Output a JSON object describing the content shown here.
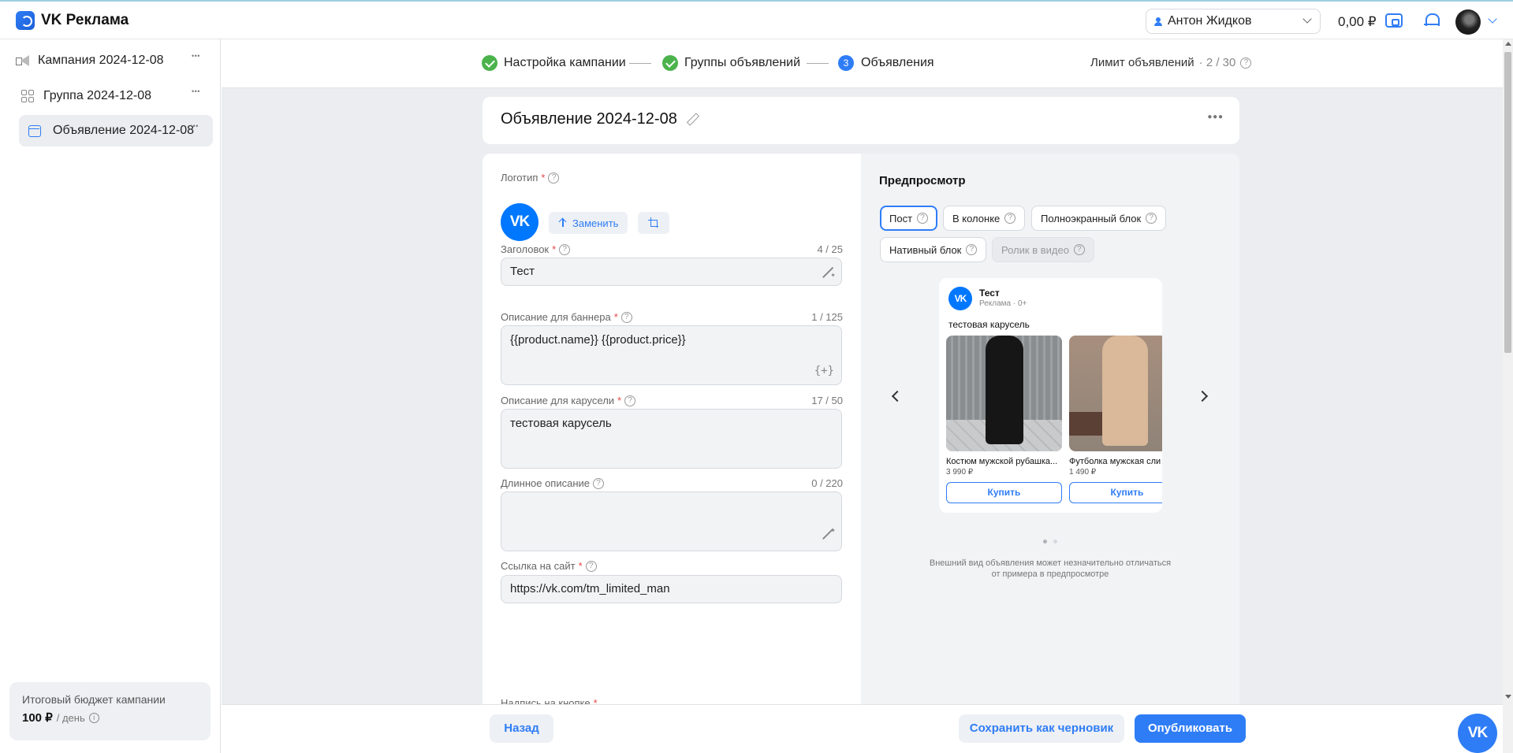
{
  "header": {
    "logo_text": "VK Реклама",
    "user_name": "Антон Жидков",
    "balance": "0,00 ₽",
    "icons": [
      "wallet-icon",
      "bell-icon",
      "avatar"
    ]
  },
  "sidebar": {
    "items": [
      {
        "label": "Кампания 2024-12-08",
        "icon": "megaphone-icon"
      },
      {
        "label": "Группа 2024-12-08",
        "icon": "grid-icon"
      },
      {
        "label": "Объявление 2024-12-08",
        "icon": "ad-icon",
        "active": true
      }
    ],
    "budget": {
      "title": "Итоговый бюджет кампании",
      "value": "100 ₽",
      "unit": "/ день"
    }
  },
  "stepper": {
    "steps": [
      {
        "label": "Настройка кампании",
        "status": "done"
      },
      {
        "label": "Группы объявлений",
        "status": "done"
      },
      {
        "label": "Объявления",
        "status": "current",
        "number": "3"
      }
    ],
    "limit_label": "Лимит объявлений",
    "limit_count": "· 2 / 30"
  },
  "ad": {
    "title": "Объявление 2024-12-08"
  },
  "form": {
    "logo": {
      "label": "Логотип",
      "logo_text": "VK",
      "replace_label": "Заменить"
    },
    "headline": {
      "label": "Заголовок",
      "count": "4 / 25",
      "value": "Тест"
    },
    "banner_desc": {
      "label": "Описание для баннера",
      "count": "1 / 125",
      "value": "{{product.name}} {{product.price}}",
      "var_icon": "{+}"
    },
    "carousel_desc": {
      "label": "Описание для карусели",
      "count": "17 / 50",
      "value": "тестовая карусель"
    },
    "long_desc": {
      "label": "Длинное описание",
      "count": "0 / 220",
      "value": ""
    },
    "site_link": {
      "label": "Ссылка на сайт",
      "value": "https://vk.com/tm_limited_man"
    },
    "button_text": {
      "label": "Надпись на кнопке"
    }
  },
  "preview": {
    "title": "Предпросмотр",
    "tabs": [
      "Пост",
      "В колонке",
      "Полноэкранный блок",
      "Нативный блок",
      "Ролик в видео"
    ],
    "active_tab": "Пост",
    "disabled_tab": "Ролик в видео",
    "post": {
      "avatar_text": "VK",
      "name": "Тест",
      "meta": "Реклама · 0+",
      "text": "тестовая карусель",
      "cards": [
        {
          "title": "Костюм мужской рубашка...",
          "price": "3 990 ₽",
          "button": "Купить"
        },
        {
          "title": "Футболка мужская сли",
          "price": "1 490 ₽",
          "button": "Купить"
        }
      ]
    },
    "carousel_page": 1,
    "carousel_pages": 2,
    "note": "Внешний вид объявления может незначительно отличаться от примера в предпросмотре"
  },
  "footer": {
    "back": "Назад",
    "save_draft": "Сохранить как черновик",
    "publish": "Опубликовать",
    "help_text": "VK"
  },
  "colors": {
    "accent": "#2f7df6",
    "success": "#4bb34b",
    "required": "#e64646",
    "background": "#ebedf0"
  }
}
